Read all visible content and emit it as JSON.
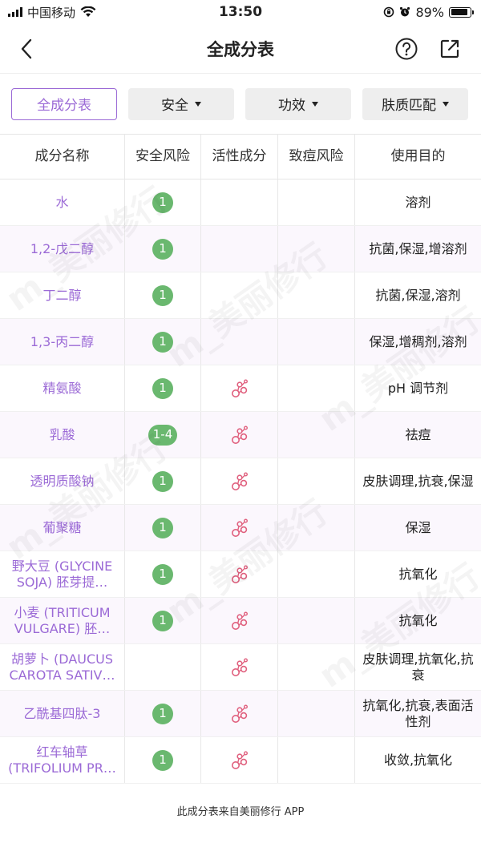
{
  "status_bar": {
    "carrier": "中国移动",
    "time": "13:50",
    "battery_percent": "89%",
    "battery_level": 0.89
  },
  "nav": {
    "title": "全成分表",
    "back_icon": "chevron-left-icon",
    "help_icon": "question-circle-icon",
    "share_icon": "share-icon"
  },
  "filters": {
    "all": "全成分表",
    "safety": "安全",
    "efficacy": "功效",
    "skin_type": "肤质匹配"
  },
  "table": {
    "headers": [
      "成分名称",
      "安全风险",
      "活性成分",
      "致痘风险",
      "使用目的"
    ],
    "rows": [
      {
        "name": "水",
        "safety": "1",
        "active": false,
        "acne": "",
        "purpose": "溶剂"
      },
      {
        "name": "1,2-戊二醇",
        "safety": "1",
        "active": false,
        "acne": "",
        "purpose": "抗菌,保湿,增溶剂"
      },
      {
        "name": "丁二醇",
        "safety": "1",
        "active": false,
        "acne": "",
        "purpose": "抗菌,保湿,溶剂"
      },
      {
        "name": "1,3-丙二醇",
        "safety": "1",
        "active": false,
        "acne": "",
        "purpose": "保湿,增稠剂,溶剂"
      },
      {
        "name": "精氨酸",
        "safety": "1",
        "active": true,
        "acne": "",
        "purpose": "pH 调节剂"
      },
      {
        "name": "乳酸",
        "safety": "1-4",
        "active": true,
        "acne": "",
        "purpose": "祛痘"
      },
      {
        "name": "透明质酸钠",
        "safety": "1",
        "active": true,
        "acne": "",
        "purpose": "皮肤调理,抗衰,保湿"
      },
      {
        "name": "葡聚糖",
        "safety": "1",
        "active": true,
        "acne": "",
        "purpose": "保湿"
      },
      {
        "name": "野大豆 (GLYCINE SOJA) 胚芽提…",
        "safety": "1",
        "active": true,
        "acne": "",
        "purpose": "抗氧化"
      },
      {
        "name": "小麦 (TRITICUM VULGARE) 胚…",
        "safety": "1",
        "active": true,
        "acne": "",
        "purpose": "抗氧化"
      },
      {
        "name": "胡萝卜 (DAUCUS CAROTA SATIV…",
        "safety": "",
        "active": true,
        "acne": "",
        "purpose": "皮肤调理,抗氧化,抗衰"
      },
      {
        "name": "乙酰基四肽-3",
        "safety": "1",
        "active": true,
        "acne": "",
        "purpose": "抗氧化,抗衰,表面活性剂"
      },
      {
        "name": "红车轴草 (TRIFOLIUM PR…",
        "safety": "1",
        "active": true,
        "acne": "",
        "purpose": "收敛,抗氧化"
      }
    ]
  },
  "footer": {
    "note": "此成分表来自美丽修行 APP"
  },
  "colors": {
    "accent": "#9b6ad6",
    "safe_badge": "#6ab86f",
    "active_icon": "#e0607e"
  }
}
